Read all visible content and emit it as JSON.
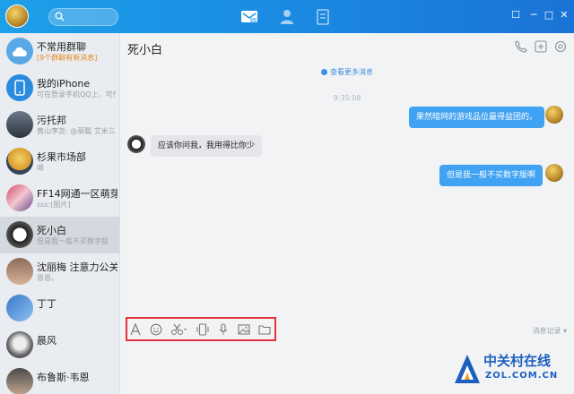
{
  "search": {
    "placeholder": ""
  },
  "window_controls": {
    "skin": "☐",
    "minimize": "─",
    "maximize": "□",
    "close": "✕"
  },
  "sidebar": {
    "contacts": [
      {
        "name": "不常用群聊",
        "sub": "[9个群聊有新消息]",
        "avatar": "group-cloud"
      },
      {
        "name": "我的iPhone",
        "sub": "可在登录手机QQ上，可传",
        "avatar": "phone"
      },
      {
        "name": "污托邦",
        "sub": "黄山李尧: @葵瓢 艾米三",
        "avatar": "tower"
      },
      {
        "name": "杉果市场部",
        "sub": "嗯",
        "avatar": "vault-boy"
      },
      {
        "name": "FF14网通一区萌芽",
        "sub": "sss:[图片]",
        "avatar": "anime"
      },
      {
        "name": "死小白",
        "sub": "但是我一般不买数字版",
        "avatar": "panda",
        "selected": true
      },
      {
        "name": "沈丽梅 注意力公关",
        "sub": "恩恩。",
        "avatar": "girl"
      },
      {
        "name": "丁丁",
        "sub": "",
        "avatar": "character"
      },
      {
        "name": "晨风",
        "sub": "",
        "avatar": "cat"
      },
      {
        "name": "布鲁斯·韦恩",
        "sub": "",
        "avatar": "man"
      }
    ]
  },
  "chat": {
    "title": "死小白",
    "more_history": "查看更多消息",
    "timestamp": "9:35:08",
    "messages": [
      {
        "direction": "out",
        "text": "果然暗网的游戏品位最得益团的。"
      },
      {
        "direction": "in",
        "text": "应该你问我，我用得比你少"
      },
      {
        "direction": "out",
        "text": "但是我一般不买数字版啊"
      }
    ],
    "history_label": "消息记录 ▾",
    "tools": [
      "font-icon",
      "emoji-icon",
      "scissors-icon",
      "shake-icon",
      "mic-icon",
      "image-icon",
      "folder-icon"
    ]
  },
  "watermark": {
    "line1": "中关村在线",
    "line2": "ZOL.COM.CN"
  },
  "colors": {
    "accent": "#1b8fe4",
    "bubble_out": "#3fa2f2",
    "highlight_box": "#e0353b"
  }
}
